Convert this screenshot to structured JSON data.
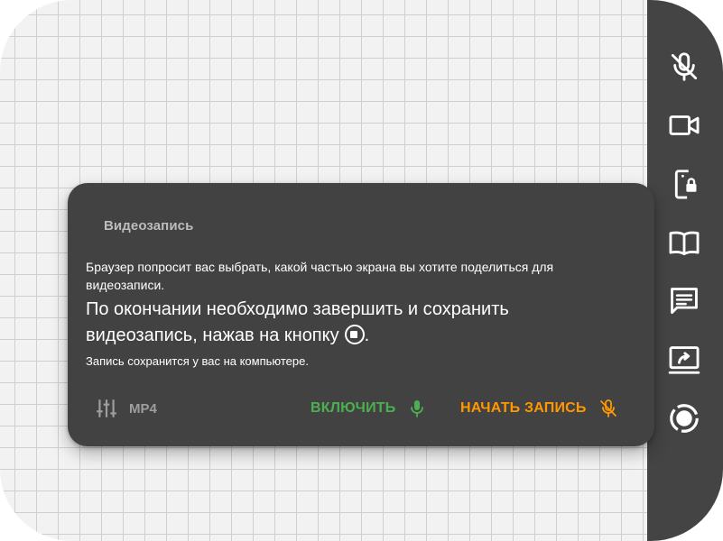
{
  "dialog": {
    "title": "Видеозапись",
    "hint": "Браузер попросит вас выбрать, какой частью экрана вы хотите поделиться для видеозаписи.",
    "main_line1": "По окончании необходимо завершить и сохранить",
    "main_line2": "видеозапись, нажав на кнопку",
    "main_line2_end": ".",
    "note": "Запись сохранится у вас на компьютере.",
    "format_label": "MP4",
    "enable_label": "ВКЛЮЧИТЬ",
    "record_label": "НАЧАТЬ ЗАПИСЬ"
  },
  "sidebar": {
    "icons": [
      "microphone-off-icon",
      "video-camera-icon",
      "screen-share-lock-icon",
      "book-icon",
      "chat-icon",
      "screen-share-icon",
      "record-icon"
    ]
  },
  "colors": {
    "sidebar_bg": "#444444",
    "dialog_bg": "#424242",
    "enable": "#4caf50",
    "record": "#ff9800",
    "muted": "#9e9e9e"
  }
}
